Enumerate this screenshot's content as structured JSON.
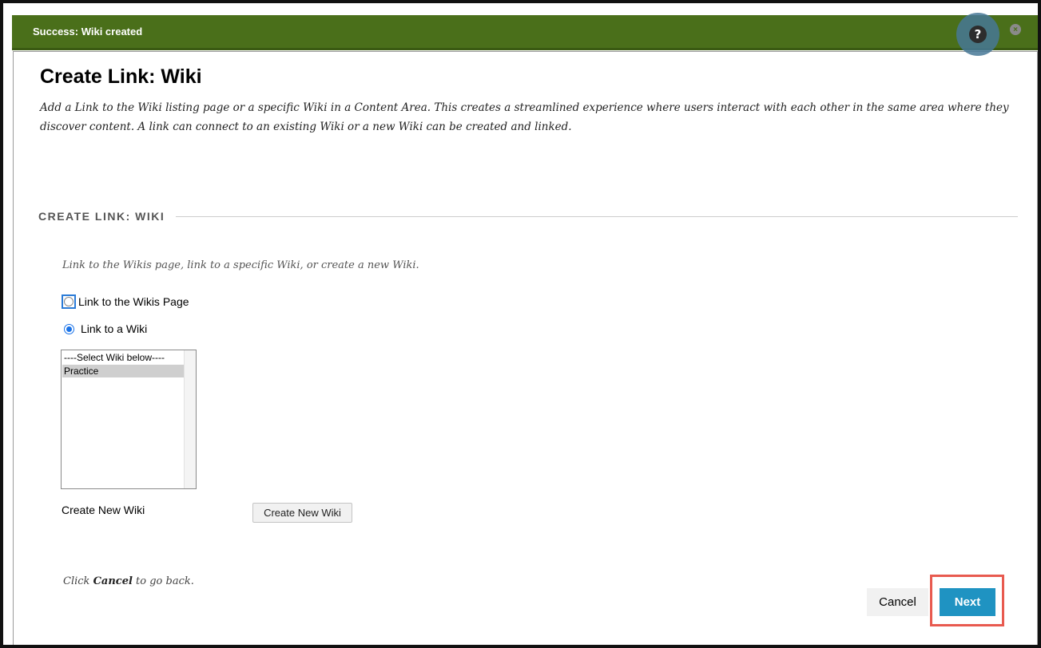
{
  "notification": {
    "message": "Success: Wiki created",
    "help_icon_glyph": "?",
    "close_icon_glyph": "×"
  },
  "page": {
    "title": "Create Link: Wiki",
    "description": "Add a Link to the Wiki listing page or a specific Wiki in a Content Area. This creates a streamlined experience where users interact with each other in the same area where they discover content. A link can connect to an existing Wiki or a new Wiki can be created and linked."
  },
  "section": {
    "heading": "CREATE LINK: WIKI",
    "instructions": "Link to the Wikis page, link to a specific Wiki, or create a new Wiki.",
    "radio_options": [
      {
        "label": "Link to the Wikis Page",
        "checked": false
      },
      {
        "label": "Link to a Wiki",
        "checked": true
      }
    ],
    "wiki_list": {
      "options": [
        "----Select Wiki below----",
        "Practice"
      ],
      "selected": "Practice"
    },
    "create_new": {
      "label": "Create New Wiki",
      "button_label": "Create New Wiki"
    }
  },
  "footer": {
    "note_prefix": "Click ",
    "note_bold": "Cancel",
    "note_suffix": " to go back.",
    "cancel_label": "Cancel",
    "next_label": "Next"
  },
  "colors": {
    "success_bar": "#4a6f1a",
    "next_button": "#1f93c2",
    "highlight_border": "#e85a4f",
    "radio_focus": "#2b7bd6"
  }
}
